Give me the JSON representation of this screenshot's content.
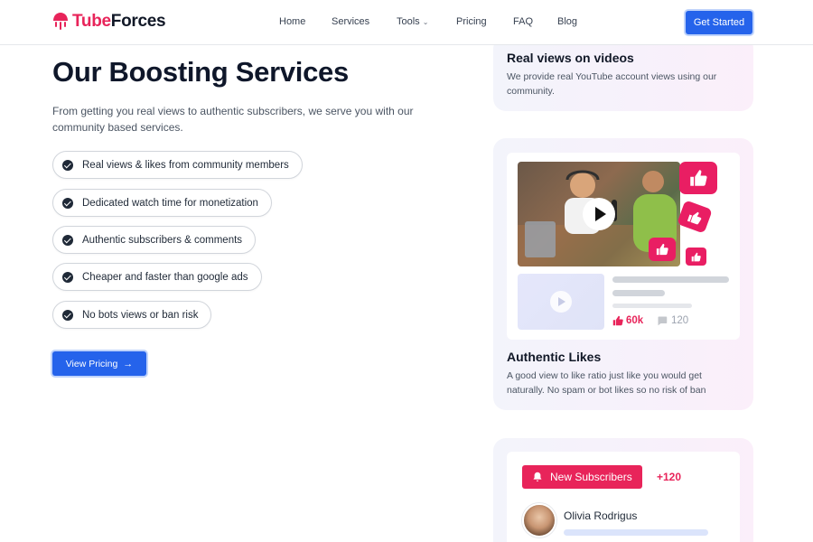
{
  "brand": {
    "name_part1": "Tube",
    "name_part2": "Forces"
  },
  "nav": {
    "items": [
      {
        "label": "Home"
      },
      {
        "label": "Services"
      },
      {
        "label": "Tools"
      },
      {
        "label": "Pricing"
      },
      {
        "label": "FAQ"
      },
      {
        "label": "Blog"
      }
    ],
    "cta_label": "Get Started"
  },
  "hero": {
    "title": "Our Boosting Services",
    "description": "From getting you real views to authentic subscribers, we serve you with our community based services.",
    "features": [
      "Real views & likes from community members",
      "Dedicated watch time for monetization",
      "Authentic subscribers & comments",
      "Cheaper and faster than google ads",
      "No bots views or ban risk"
    ],
    "button_label": "View Pricing"
  },
  "cards": {
    "views": {
      "title": "Real views on videos",
      "description": "We provide real YouTube account views using our community."
    },
    "likes": {
      "title": "Authentic Likes",
      "description": "A good view to like ratio just like you would get naturally. No spam or bot likes so no risk of ban",
      "likes_count": "60k",
      "comments_count": "120"
    },
    "subscribers": {
      "pill_label": "New Subscribers",
      "count": "+120",
      "subscriber_name": "Olivia Rodrigus"
    }
  },
  "colors": {
    "brand": "#e8245a",
    "primary": "#2563eb",
    "text": "#111827"
  }
}
